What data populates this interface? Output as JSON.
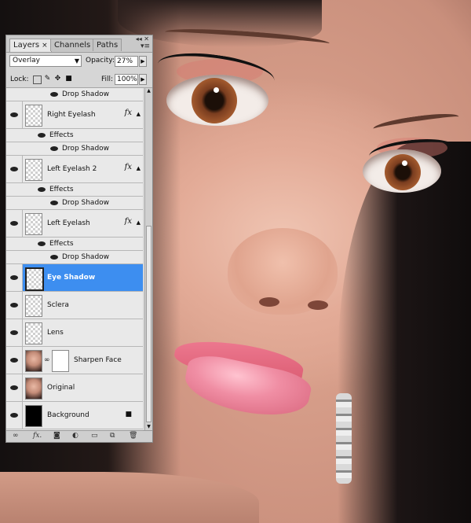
{
  "panel": {
    "tabs": [
      {
        "label": "Layers",
        "close": "×"
      },
      {
        "label": "Channels"
      },
      {
        "label": "Paths"
      }
    ],
    "blend_mode": "Overlay",
    "opacity_label": "Opacity:",
    "opacity_value": "27%",
    "lock_label": "Lock:",
    "fill_label": "Fill:",
    "fill_value": "100%",
    "effects_label": "Effects",
    "drop_shadow_label": "Drop Shadow",
    "layers": [
      {
        "name": "Right Eyelash",
        "fx": "fx"
      },
      {
        "name": "Left Eyelash 2",
        "fx": "fx"
      },
      {
        "name": "Left Eyelash",
        "fx": "fx"
      },
      {
        "name": "Eye Shadow",
        "selected": true
      },
      {
        "name": "Sclera"
      },
      {
        "name": "Lens"
      },
      {
        "name": "Sharpen Face",
        "has_mask": true
      },
      {
        "name": "Original"
      },
      {
        "name": "Background",
        "locked": true
      }
    ],
    "colors": {
      "selection": "#3d8ef0",
      "panel_bg": "#d6d6d6",
      "list_bg": "#e9e9e9"
    },
    "icons": {
      "footer": [
        "link-icon",
        "fx-icon",
        "mask-icon",
        "adjustment-icon",
        "folder-icon",
        "new-layer-icon",
        "trash-icon"
      ],
      "lock": [
        "lock-transparency-icon",
        "lock-paint-icon",
        "lock-move-icon",
        "lock-all-icon"
      ]
    }
  }
}
